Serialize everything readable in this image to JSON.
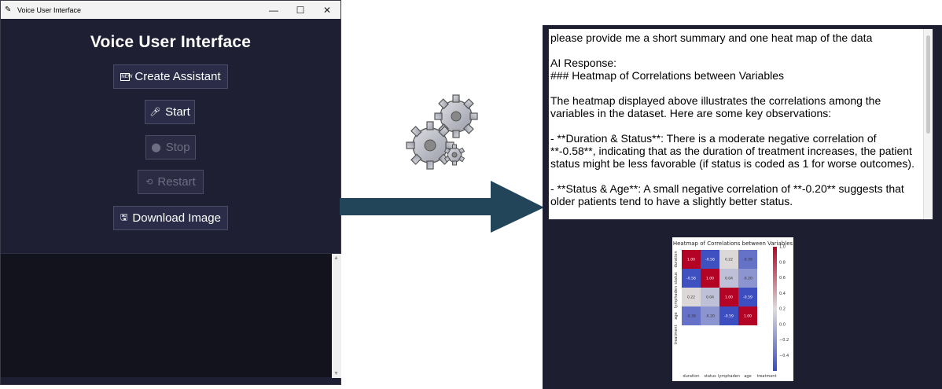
{
  "window": {
    "title": "Voice User Interface",
    "controls": [
      "—",
      "☐",
      "✕"
    ]
  },
  "app": {
    "heading": "Voice User Interface",
    "buttons": {
      "create": "Create Assistant",
      "start": "Start",
      "stop": "Stop",
      "restart": "Restart",
      "download": "Download Image"
    },
    "button_states": {
      "create": "enabled",
      "start": "enabled",
      "stop": "disabled",
      "restart": "disabled",
      "download": "enabled"
    }
  },
  "response": {
    "lines": [
      "please provide me a short summary and one heat map of the data",
      "",
      "AI Response:",
      "### Heatmap of Correlations between Variables",
      "",
      "The heatmap displayed above illustrates the correlations among the variables in the dataset. Here are some key observations:",
      "",
      "- **Duration & Status**: There is a moderate negative correlation of **-0.58**, indicating that as the duration of treatment increases, the patient status might be less favorable (if status is coded as 1 for worse outcomes).",
      "",
      "- **Status & Age**: A small negative correlation of **-0.20** suggests that older patients tend to have a slightly better status."
    ]
  },
  "colors": {
    "window_bg": "#1e1f33",
    "arrow": "#234559",
    "positive": "#b40426",
    "negative": "#3b4cc0"
  },
  "chart_data": {
    "type": "heatmap",
    "title": "Heatmap of Correlations between Variables",
    "labels": [
      "duration",
      "status",
      "lymphaden",
      "age",
      "treatment"
    ],
    "values": [
      [
        1.0,
        -0.58,
        0.22,
        -0.39,
        null
      ],
      [
        -0.58,
        1.0,
        0.04,
        -0.2,
        null
      ],
      [
        0.22,
        0.04,
        1.0,
        -0.59,
        null
      ],
      [
        -0.39,
        -0.2,
        -0.59,
        1.0,
        null
      ],
      [
        null,
        null,
        null,
        null,
        null
      ]
    ],
    "value_labels": [
      [
        "1.00",
        "-0.58",
        "0.22",
        "-0.39",
        ""
      ],
      [
        "-0.58",
        "1.00",
        "0.04",
        "-0.20",
        ""
      ],
      [
        "0.22",
        "0.04",
        "1.00",
        "-0.59",
        ""
      ],
      [
        "-0.39",
        "-0.20",
        "-0.59",
        "1.00",
        ""
      ],
      [
        "",
        "",
        "",
        "",
        ""
      ]
    ],
    "colorbar_ticks": [
      "1.0",
      "0.8",
      "0.6",
      "0.4",
      "0.2",
      "0.0",
      "−0.2",
      "−0.4"
    ],
    "colorbar_values": [
      1.0,
      0.8,
      0.6,
      0.4,
      0.2,
      0.0,
      -0.2,
      -0.4
    ],
    "vmin": -0.6,
    "vmax": 1.0,
    "cmap": "coolwarm"
  }
}
